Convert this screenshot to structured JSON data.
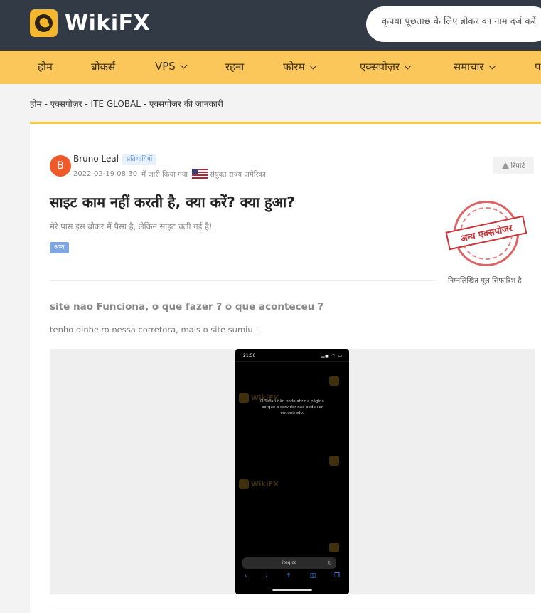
{
  "header": {
    "logo_text": "WikiFX",
    "search_placeholder": "कृपया पूछताछ के लिए ब्रोकर का नाम दर्ज करें"
  },
  "nav": {
    "items": [
      {
        "label": "होम",
        "dropdown": false
      },
      {
        "label": "ब्रोकर्स",
        "dropdown": false
      },
      {
        "label": "VPS",
        "dropdown": true
      },
      {
        "label": "रहना",
        "dropdown": false
      },
      {
        "label": "फोरम",
        "dropdown": true
      },
      {
        "label": "एक्सपोज़र",
        "dropdown": true
      },
      {
        "label": "समाचार",
        "dropdown": true
      },
      {
        "label": "प",
        "dropdown": false
      }
    ]
  },
  "breadcrumb": {
    "items": [
      "होम",
      "एक्सपोज़र",
      "ITE GLOBAL",
      "एक्सपोजर की जानकारी"
    ],
    "separator": " - "
  },
  "post": {
    "avatar_letter": "B",
    "author": "Bruno Leal",
    "role": "प्रतिभागियों",
    "datetime": "2022-02-19 08:30",
    "posted_label": "में जारी किया गया",
    "country": "संयुक्त राज्य अमेरिका",
    "report_label": "रिपोर्ट",
    "title": "साइट काम नहीं करती है, क्या करें? क्या हुआ?",
    "subtitle": "मेरे पास इस ब्रोकर में पैसा है, लेकिन साइट चली गई है!",
    "tag": "अन्य",
    "stamp_text": "अन्य एक्सपोजर",
    "stamp_caption": "निम्नलिखित मूल सिफारिश है",
    "original_title": "site não Funciona, o que fazer ? o que aconteceu ?",
    "original_body": "tenho dinheiro nessa corretora, mais o site sumiu !"
  },
  "screenshot": {
    "time": "21:56",
    "status_icons": "▂▄ ◠ ▭",
    "message": "O Safari não pode abrir a página porque o servidor não pode ser encontrado.",
    "watermark": "WikiFX",
    "url": "iteg.cc",
    "tools": [
      "‹",
      "›",
      "⇪",
      "◫",
      "❐"
    ]
  },
  "colors": {
    "header_bg": "#323a45",
    "nav_bg": "#fcc75a",
    "accent": "#f3b62c",
    "avatar": "#ef5a2b",
    "stamp": "#c9363b"
  }
}
